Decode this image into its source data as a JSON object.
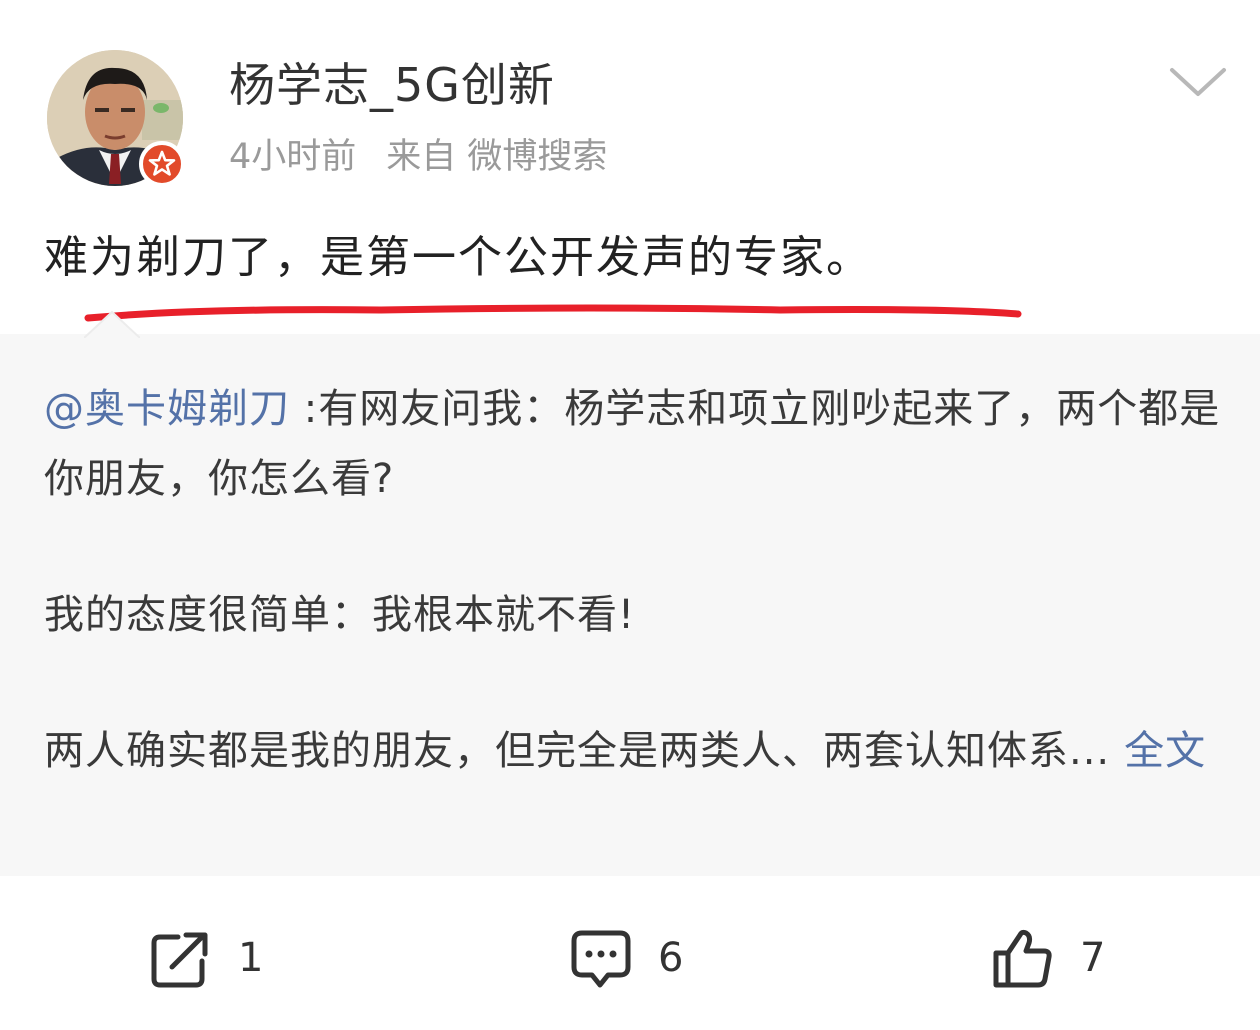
{
  "post": {
    "username": "杨学志_5G创新",
    "time": "4小时前",
    "source": "来自 微博搜索",
    "text": "难为剃刀了，是第一个公开发声的专家。",
    "avatar_icon": "user-avatar-icon",
    "verified_icon": "verified-badge-icon",
    "menu_icon": "chevron-down-icon",
    "underline_color": "#e8202a"
  },
  "repost": {
    "mention": "@奥卡姆剃刀",
    "line1": " :有网友问我：杨学志和项立刚吵起来了，两个都是你朋友，你怎么看?",
    "line2": "我的态度很简单：我根本就不看!",
    "line3": "两人确实都是我的朋友，但完全是两类人、两套认知体系...",
    "more_label": "全文",
    "link_color": "#5472a8"
  },
  "actions": {
    "repost_count": "1",
    "comment_count": "6",
    "like_count": "7",
    "repost_icon": "share-icon",
    "comment_icon": "comment-icon",
    "like_icon": "thumbs-up-icon"
  }
}
